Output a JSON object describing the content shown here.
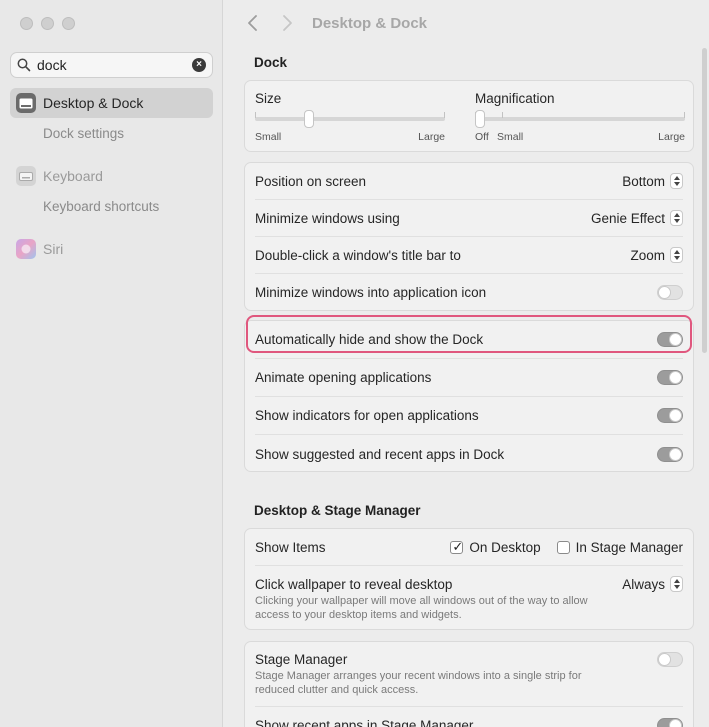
{
  "sidebar": {
    "search_value": "dock",
    "items": [
      {
        "label": "Desktop & Dock",
        "selected": true
      },
      {
        "label": "Dock settings"
      },
      {
        "label": "Keyboard"
      },
      {
        "label": "Keyboard shortcuts"
      },
      {
        "label": "Siri"
      }
    ]
  },
  "header": {
    "title": "Desktop & Dock"
  },
  "dock": {
    "section_title": "Dock",
    "size": {
      "label": "Size",
      "min_label": "Small",
      "max_label": "Large",
      "value": 0.27
    },
    "magnification": {
      "label": "Magnification",
      "off_label": "Off",
      "min_label": "Small",
      "max_label": "Large",
      "value": 0.0
    },
    "position": {
      "label": "Position on screen",
      "value": "Bottom"
    },
    "minimize_using": {
      "label": "Minimize windows using",
      "value": "Genie Effect"
    },
    "double_click": {
      "label": "Double-click a window's title bar to",
      "value": "Zoom"
    },
    "minimize_into_icon": {
      "label": "Minimize windows into application icon",
      "on": false
    },
    "auto_hide": {
      "label": "Automatically hide and show the Dock",
      "on": true
    },
    "animate": {
      "label": "Animate opening applications",
      "on": true
    },
    "indicators": {
      "label": "Show indicators for open applications",
      "on": true
    },
    "suggested": {
      "label": "Show suggested and recent apps in Dock",
      "on": true
    }
  },
  "stage": {
    "section_title": "Desktop & Stage Manager",
    "show_items": {
      "label": "Show Items",
      "on_desktop": "On Desktop",
      "in_stage_manager": "In Stage Manager"
    },
    "click_wallpaper": {
      "label": "Click wallpaper to reveal desktop",
      "value": "Always",
      "desc": "Clicking your wallpaper will move all windows out of the way to allow access to your desktop items and widgets."
    },
    "stage_manager": {
      "label": "Stage Manager",
      "desc": "Stage Manager arranges your recent windows into a single strip for reduced clutter and quick access.",
      "on": false
    },
    "recent_apps": {
      "label": "Show recent apps in Stage Manager",
      "on": true
    }
  },
  "colors": {
    "highlight": "#e0577e"
  }
}
